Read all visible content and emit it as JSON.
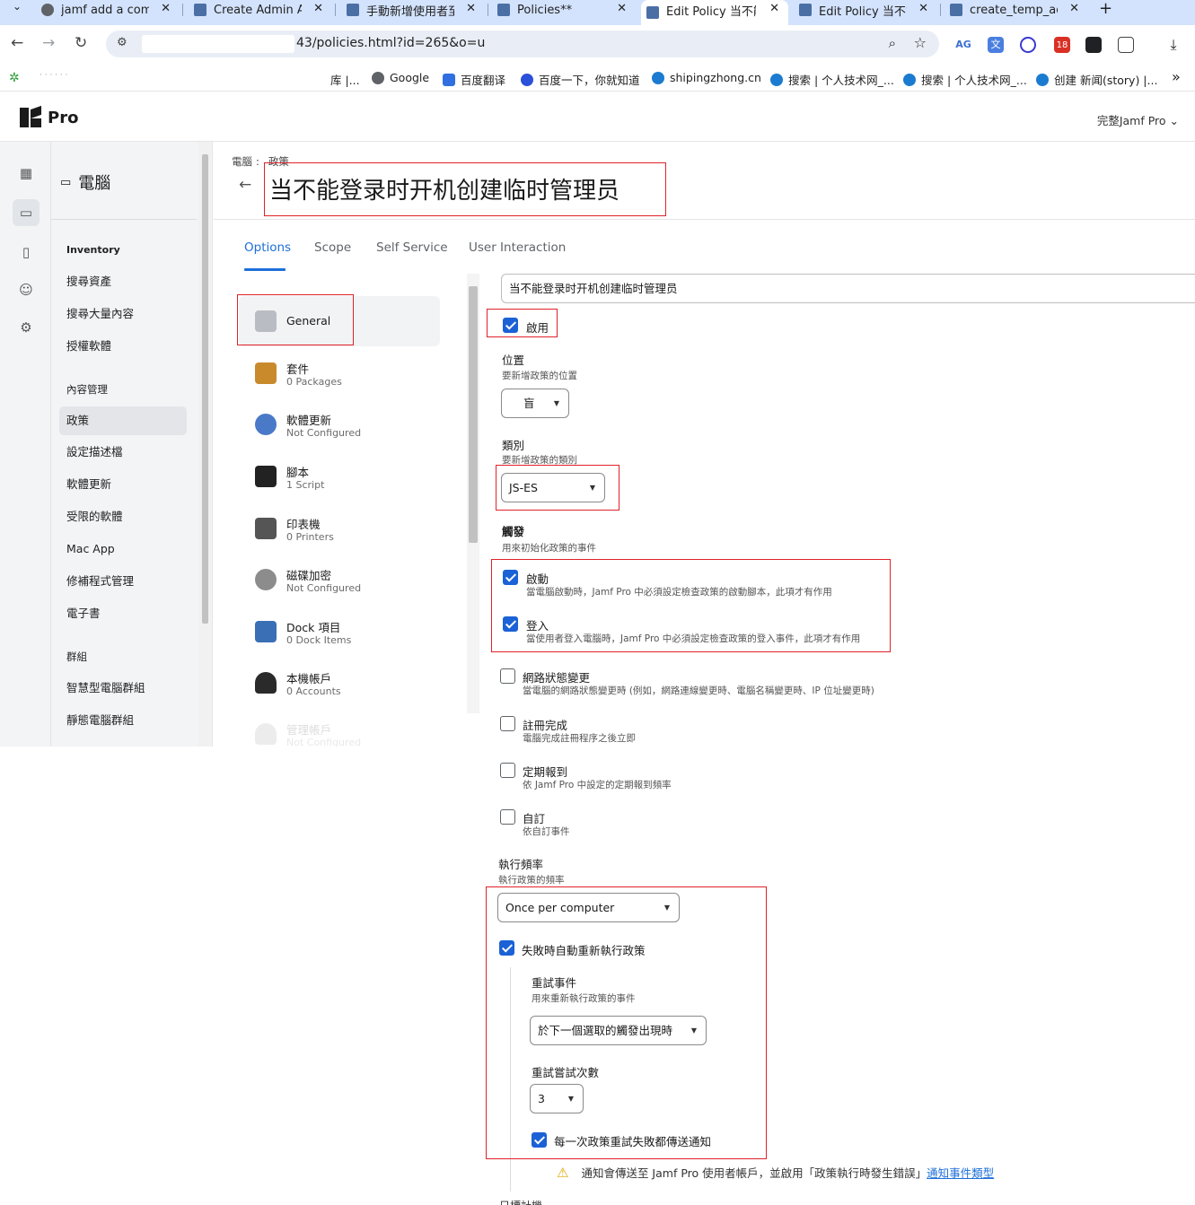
{
  "browser": {
    "tabs": [
      {
        "title": "jamf add a comp",
        "icon": "google-icon"
      },
      {
        "title": "Create Admin Ac",
        "icon": "jamf-icon"
      },
      {
        "title": "手動新增使用者至",
        "icon": "jamf-icon"
      },
      {
        "title": "Policies**",
        "icon": "jamf-icon"
      },
      {
        "title": "Edit Policy 当不能",
        "icon": "jamf-icon"
      },
      {
        "title": "Edit Policy 当不能",
        "icon": "jamf-icon"
      },
      {
        "title": "create_temp_adm",
        "icon": "jamf-icon"
      }
    ],
    "close_glyph": "✕",
    "new_tab_glyph": "+",
    "url": "43/policies.html?id=265&o=u",
    "extension_badge": "18",
    "bookmarks": [
      {
        "label": "库 |...",
        "icon": ""
      },
      {
        "label": "Google",
        "icon": "google-icon"
      },
      {
        "label": "百度翻译",
        "icon": "translate-icon"
      },
      {
        "label": "百度一下，你就知道",
        "icon": "baidu-icon"
      },
      {
        "label": "shipingzhong.cn",
        "icon": "drupal-icon"
      },
      {
        "label": "搜索 | 个人技术网_...",
        "icon": "drupal-icon"
      },
      {
        "label": "搜索 | 个人技术网_...",
        "icon": "drupal-icon"
      },
      {
        "label": "创建 新闻(story) |...",
        "icon": "drupal-icon"
      }
    ],
    "more_bookmarks_glyph": "»"
  },
  "app": {
    "logo_text": "Pro",
    "user_menu": "完整Jamf Pro ⌄"
  },
  "sidebar": {
    "title": "電腦",
    "items": [
      {
        "label": "Inventory",
        "head": true
      },
      {
        "label": "搜尋資產"
      },
      {
        "label": "搜尋大量內容"
      },
      {
        "label": "授權軟體"
      },
      {
        "label": "內容管理",
        "head": false
      },
      {
        "label": "政策",
        "active": true
      },
      {
        "label": "設定描述檔"
      },
      {
        "label": "軟體更新"
      },
      {
        "label": "受限的軟體"
      },
      {
        "label": "Mac App"
      },
      {
        "label": "修補程式管理"
      },
      {
        "label": "電子書"
      },
      {
        "label": "群組"
      },
      {
        "label": "智慧型電腦群組"
      },
      {
        "label": "靜態電腦群組"
      }
    ]
  },
  "page": {
    "breadcrumb": [
      "電腦",
      "政策"
    ],
    "breadcrumb_sep": ":",
    "title": "当不能登录时开机创建临时管理员",
    "tabs": [
      "Options",
      "Scope",
      "Self Service",
      "User Interaction"
    ]
  },
  "payloads": [
    {
      "name": "General",
      "sub": "",
      "color": "#b9bcc2"
    },
    {
      "name": "套件",
      "sub": "0 Packages",
      "color": "#c98a2c"
    },
    {
      "name": "軟體更新",
      "sub": "Not Configured",
      "color": "#4a79c8"
    },
    {
      "name": "腳本",
      "sub": "1 Script",
      "color": "#222222"
    },
    {
      "name": "印表機",
      "sub": "0 Printers",
      "color": "#555555"
    },
    {
      "name": "磁碟加密",
      "sub": "Not Configured",
      "color": "#8c8c8c"
    },
    {
      "name": "Dock 項目",
      "sub": "0 Dock Items",
      "color": "#3a6fb5"
    },
    {
      "name": "本機帳戶",
      "sub": "0 Accounts",
      "color": "#2a2a2a"
    },
    {
      "name": "管理帳戶",
      "sub": "Not Configured",
      "color": "#888888"
    }
  ],
  "form": {
    "display_name": "当不能登录时开机创建临时管理员",
    "enabled_label": "啟用",
    "site_label": "位置",
    "site_hint": "要新增政策的位置",
    "site_value": "盲",
    "category_label": "類別",
    "category_hint": "要新增政策的類別",
    "category_value": "JS-ES",
    "trigger_label": "觸發",
    "trigger_hint": "用來初始化政策的事件",
    "triggers": [
      {
        "label": "啟動",
        "hint": "當電腦啟動時，Jamf Pro 中必須設定檢查政策的啟動腳本，此項才有作用",
        "checked": true
      },
      {
        "label": "登入",
        "hint": "當使用者登入電腦時，Jamf Pro 中必須設定檢查政策的登入事件，此項才有作用",
        "checked": true
      },
      {
        "label": "網路狀態變更",
        "hint": "當電腦的網路狀態變更時 (例如，網路連線變更時、電腦名稱變更時、IP 位址變更時)",
        "checked": false
      },
      {
        "label": "註冊完成",
        "hint": "電腦完成註冊程序之後立即",
        "checked": false
      },
      {
        "label": "定期報到",
        "hint": "依 Jamf Pro 中設定的定期報到頻率",
        "checked": false
      },
      {
        "label": "自訂",
        "hint": "依自訂事件",
        "checked": false
      }
    ],
    "frequency_label": "執行頻率",
    "frequency_hint": "執行政策的頻率",
    "frequency_value": "Once per computer",
    "retry_label": "失敗時自動重新執行政策",
    "retry_event_label": "重試事件",
    "retry_event_hint": "用來重新執行政策的事件",
    "retry_event_value": "於下一個選取的觸發出現時",
    "retry_count_label": "重試嘗試次數",
    "retry_count_value": "3",
    "notify_label": "每一次政策重試失敗都傳送通知",
    "warning_text": "通知會傳送至 Jamf Pro 使用者帳戶，並啟用「政策執行時發生錯誤」",
    "warning_link": "通知事件類型",
    "cut_label": "日標計機"
  }
}
